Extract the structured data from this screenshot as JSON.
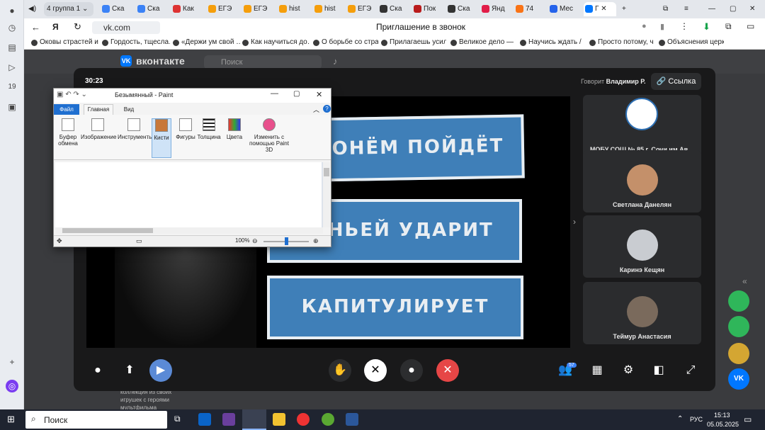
{
  "browser": {
    "tab_count": "4",
    "tabs": [
      {
        "label": "группа 1"
      },
      {
        "label": "Ска"
      },
      {
        "label": "Ска"
      },
      {
        "label": "Как"
      },
      {
        "label": "ЕГЭ"
      },
      {
        "label": "ЕГЭ"
      },
      {
        "label": "hist"
      },
      {
        "label": "hist"
      },
      {
        "label": "ЕГЭ"
      },
      {
        "label": "Ска"
      },
      {
        "label": "Пок"
      },
      {
        "label": "Ска"
      },
      {
        "label": "Янд"
      },
      {
        "label": "74"
      },
      {
        "label": "Мес"
      },
      {
        "label": "Г"
      }
    ],
    "address": "vk.com",
    "page_title": "Приглашение в звонок",
    "bookmarks": [
      "Оковы страстей и…",
      "Гордость, тщесла…",
      "«Держи ум свой …",
      "Как научиться до…",
      "О борьбе со стра…",
      "Прилагаешь усил…",
      "Великое дело — у…",
      "Научись ждать / …",
      "Просто потому, ч…",
      "Объяснения церк…"
    ]
  },
  "vk": {
    "logo": "вконтакте",
    "search_placeholder": "Поиск"
  },
  "call": {
    "timer": "30:23",
    "speaking_prefix": "Говорит",
    "speaking_name": "Владимир Р.",
    "link_button": "Ссылка",
    "banners": [
      "ОНЁМ ПОЙДЁТ",
      "ВИНЬЕЙ УДАРИТ",
      "КАПИТУЛИРУЕТ"
    ],
    "participants": [
      {
        "name": "МОБУ СОШ № 85 г. Сочи им.Ав…"
      },
      {
        "name": "Светлана Данелян"
      },
      {
        "name": "Каринэ Кещян"
      },
      {
        "name": "Теймур Анастасия"
      }
    ],
    "participants_count": "57",
    "below_text": "коллекция из своих игрушек с героями мультфильма"
  },
  "paint": {
    "title": "Безымянный - Paint",
    "file_tab": "Файл",
    "home_tab": "Главная",
    "view_tab": "Вид",
    "groups": [
      "Буфер обмена",
      "Изображение",
      "Инструменты",
      "Кисти",
      "Фигуры",
      "Толщина",
      "Цвета",
      "Изменить с помощью Paint 3D"
    ],
    "zoom": "100%",
    "zoom_level": 0.5
  },
  "taskbar": {
    "search": "Поиск",
    "lang": "РУС",
    "time": "15:13",
    "date": "05.05.2025"
  },
  "colors": {
    "accent": "#3f7fb8",
    "end_call": "#e64646",
    "vk": "#0077ff"
  }
}
